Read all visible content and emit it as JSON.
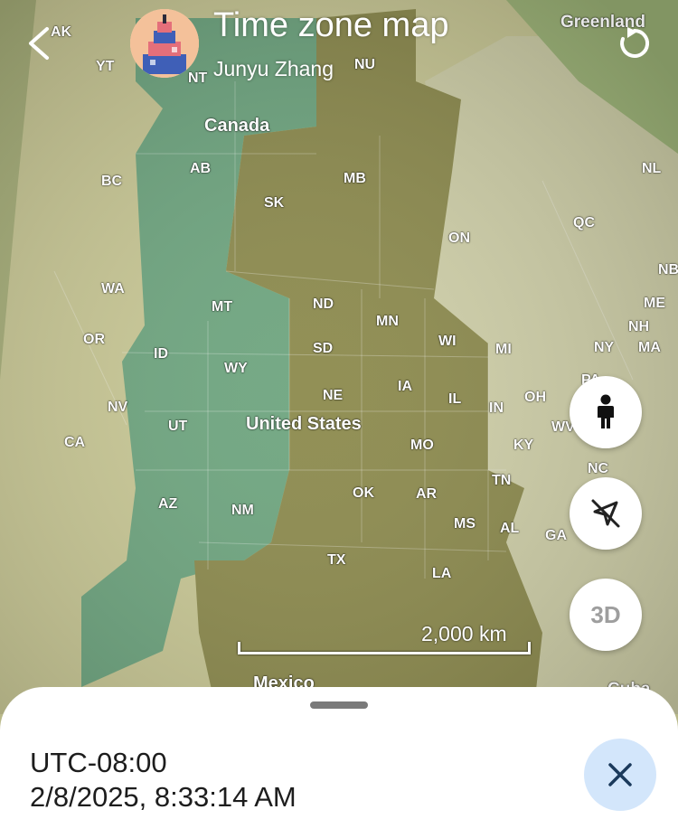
{
  "header": {
    "title": "Time zone map",
    "author": "Junyu Zhang"
  },
  "map": {
    "countries": {
      "canada": "Canada",
      "united_states": "United States",
      "mexico": "Mexico",
      "greenland": "Greenland",
      "cuba": "Cuba"
    },
    "regions": {
      "AK": "AK",
      "YT": "YT",
      "NT": "NT",
      "NU": "NU",
      "BC": "BC",
      "AB": "AB",
      "SK": "SK",
      "MB": "MB",
      "ON": "ON",
      "QC": "QC",
      "NL": "NL",
      "NB": "NB",
      "WA": "WA",
      "OR": "OR",
      "CA": "CA",
      "NV": "NV",
      "ID": "ID",
      "MT": "MT",
      "WY": "WY",
      "UT": "UT",
      "AZ": "AZ",
      "NM": "NM",
      "ND": "ND",
      "SD": "SD",
      "NE": "NE",
      "MN": "MN",
      "IA": "IA",
      "WI": "WI",
      "IL": "IL",
      "MI": "MI",
      "IN": "IN",
      "OH": "OH",
      "MO": "MO",
      "KY": "KY",
      "OK": "OK",
      "AR": "AR",
      "TN": "TN",
      "TX": "TX",
      "MS": "MS",
      "AL": "AL",
      "LA": "LA",
      "GA": "GA",
      "NC": "NC",
      "WV": "WV",
      "PA": "PA",
      "NY": "NY",
      "MA": "MA",
      "NH": "NH",
      "ME": "ME"
    },
    "scale_label": "2,000 km",
    "zone_colors": {
      "pacific": "#d1d09a",
      "mountain": "#6fa57e",
      "central": "#8c8a4d",
      "eastern": "#cfcfa6",
      "atlantic": "#a3b77a"
    }
  },
  "controls": {
    "three_d_label": "3D",
    "icons": [
      "back-arrow-icon",
      "reset-rotation-icon",
      "pegman-icon",
      "compass-off-icon",
      "close-icon"
    ]
  },
  "selection": {
    "utc_offset": "UTC-08:00",
    "local_time": "2/8/2025, 8:33:14 AM"
  }
}
